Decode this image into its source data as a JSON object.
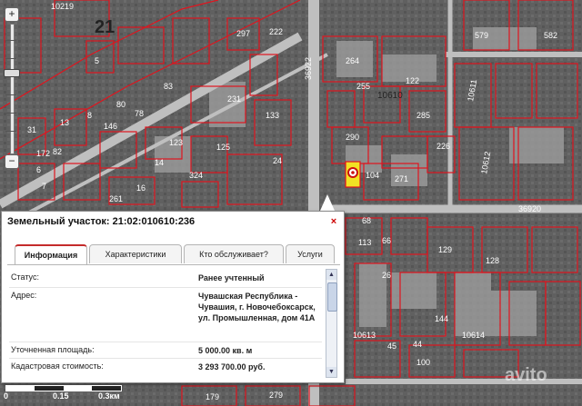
{
  "map": {
    "district_label": "21",
    "quarter_labels": [
      "10219",
      "10610",
      "10611",
      "10612",
      "10613",
      "10614",
      "36922",
      "36920"
    ],
    "parcel_labels": [
      "5",
      "6",
      "7",
      "8",
      "13",
      "14",
      "16",
      "24",
      "26",
      "31",
      "44",
      "45",
      "66",
      "68",
      "78",
      "80",
      "82",
      "83",
      "100",
      "104",
      "113",
      "122",
      "123",
      "125",
      "128",
      "129",
      "133",
      "144",
      "146",
      "172",
      "179",
      "222",
      "226",
      "231",
      "255",
      "261",
      "264",
      "271",
      "279",
      "285",
      "290",
      "297",
      "324",
      "579",
      "582"
    ]
  },
  "popup": {
    "title": "Земельный участок: 21:02:010610:236",
    "close_glyph": "×",
    "tabs": [
      "Информация",
      "Характеристики",
      "Кто обслуживает?",
      "Услуги"
    ],
    "rows": [
      {
        "label": "Статус:",
        "value": "Ранее учтенный"
      },
      {
        "label": "Адрес:",
        "value": "Чувашская Республика - Чувашия, г. Новочебоксарск, ул. Промышленная, дом 41А"
      },
      {
        "label": "Уточненная площадь:",
        "value": "5 000.00 кв. м"
      },
      {
        "label": "Кадастровая стоимость:",
        "value": "3 293 700.00 руб."
      }
    ]
  },
  "zoom": {
    "plus": "+",
    "minus": "−"
  },
  "scale": {
    "labels": [
      "0",
      "0.15",
      "0.3км"
    ]
  },
  "watermark": "avito",
  "colors": {
    "parcel_border": "#e0141e",
    "selected_parcel": "#f2e224",
    "marker": "#cc1010",
    "active_tab_accent": "#c42b2b"
  }
}
